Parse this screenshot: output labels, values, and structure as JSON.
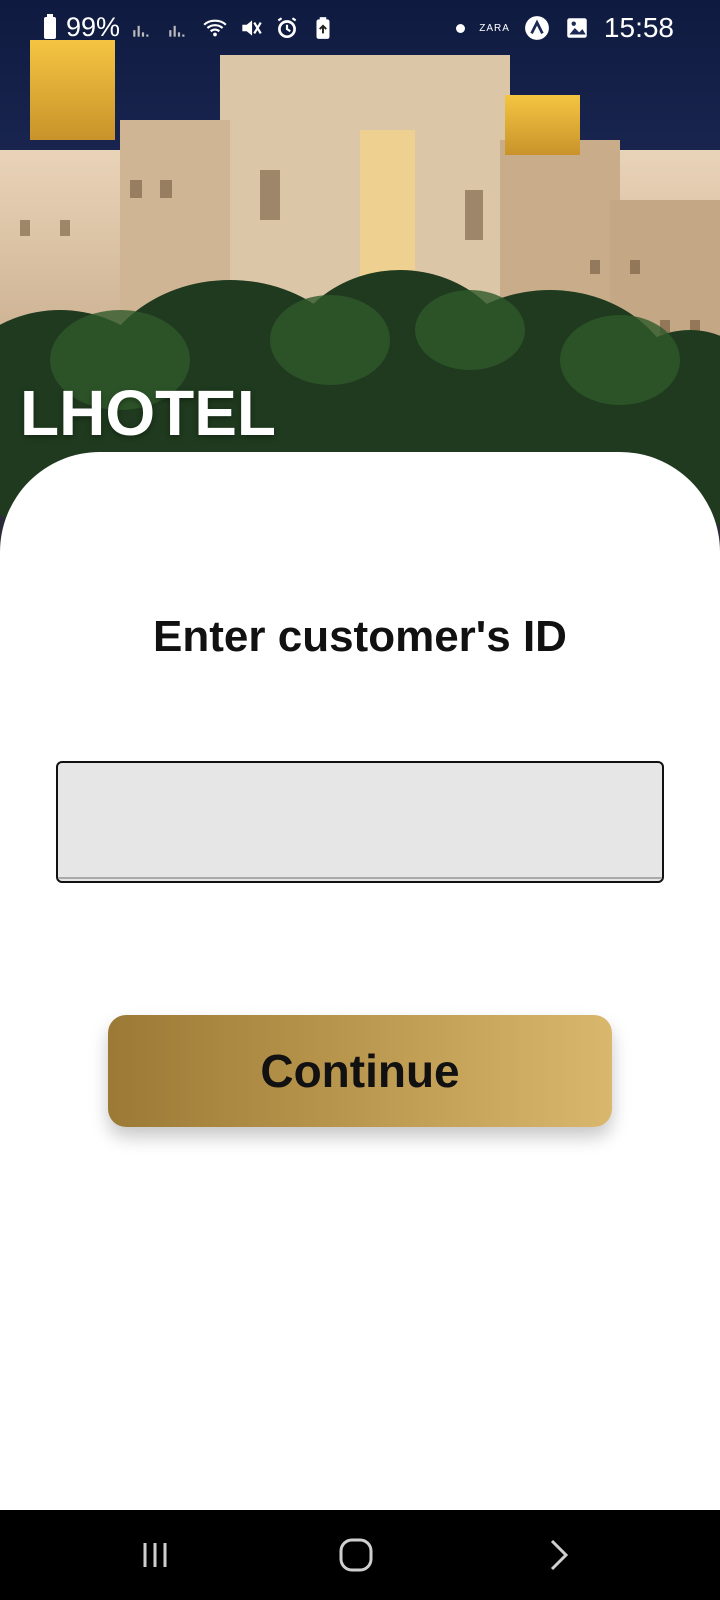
{
  "status_bar": {
    "battery": "99%",
    "time": "15:58",
    "icons": [
      "battery-icon",
      "signal-icon",
      "signal-icon",
      "wifi-icon",
      "mute-icon",
      "alarm-icon",
      "battery-saver-icon",
      "dot-icon",
      "zara-icon",
      "app-a-icon",
      "gallery-icon"
    ],
    "zara_label": "ZARA"
  },
  "hero": {
    "brand": "LHOTEL",
    "image": "hotel-night-image"
  },
  "form": {
    "title": "Enter customer's ID",
    "id_value": "",
    "id_placeholder": "",
    "continue_label": "Continue"
  },
  "colors": {
    "button_gradient_start": "#9b7a36",
    "button_gradient_end": "#d9b76c",
    "input_background": "#e6e6e6",
    "navbar": "#000000"
  },
  "nav_bar": {
    "buttons": [
      "recents-icon",
      "home-icon",
      "back-icon"
    ]
  }
}
